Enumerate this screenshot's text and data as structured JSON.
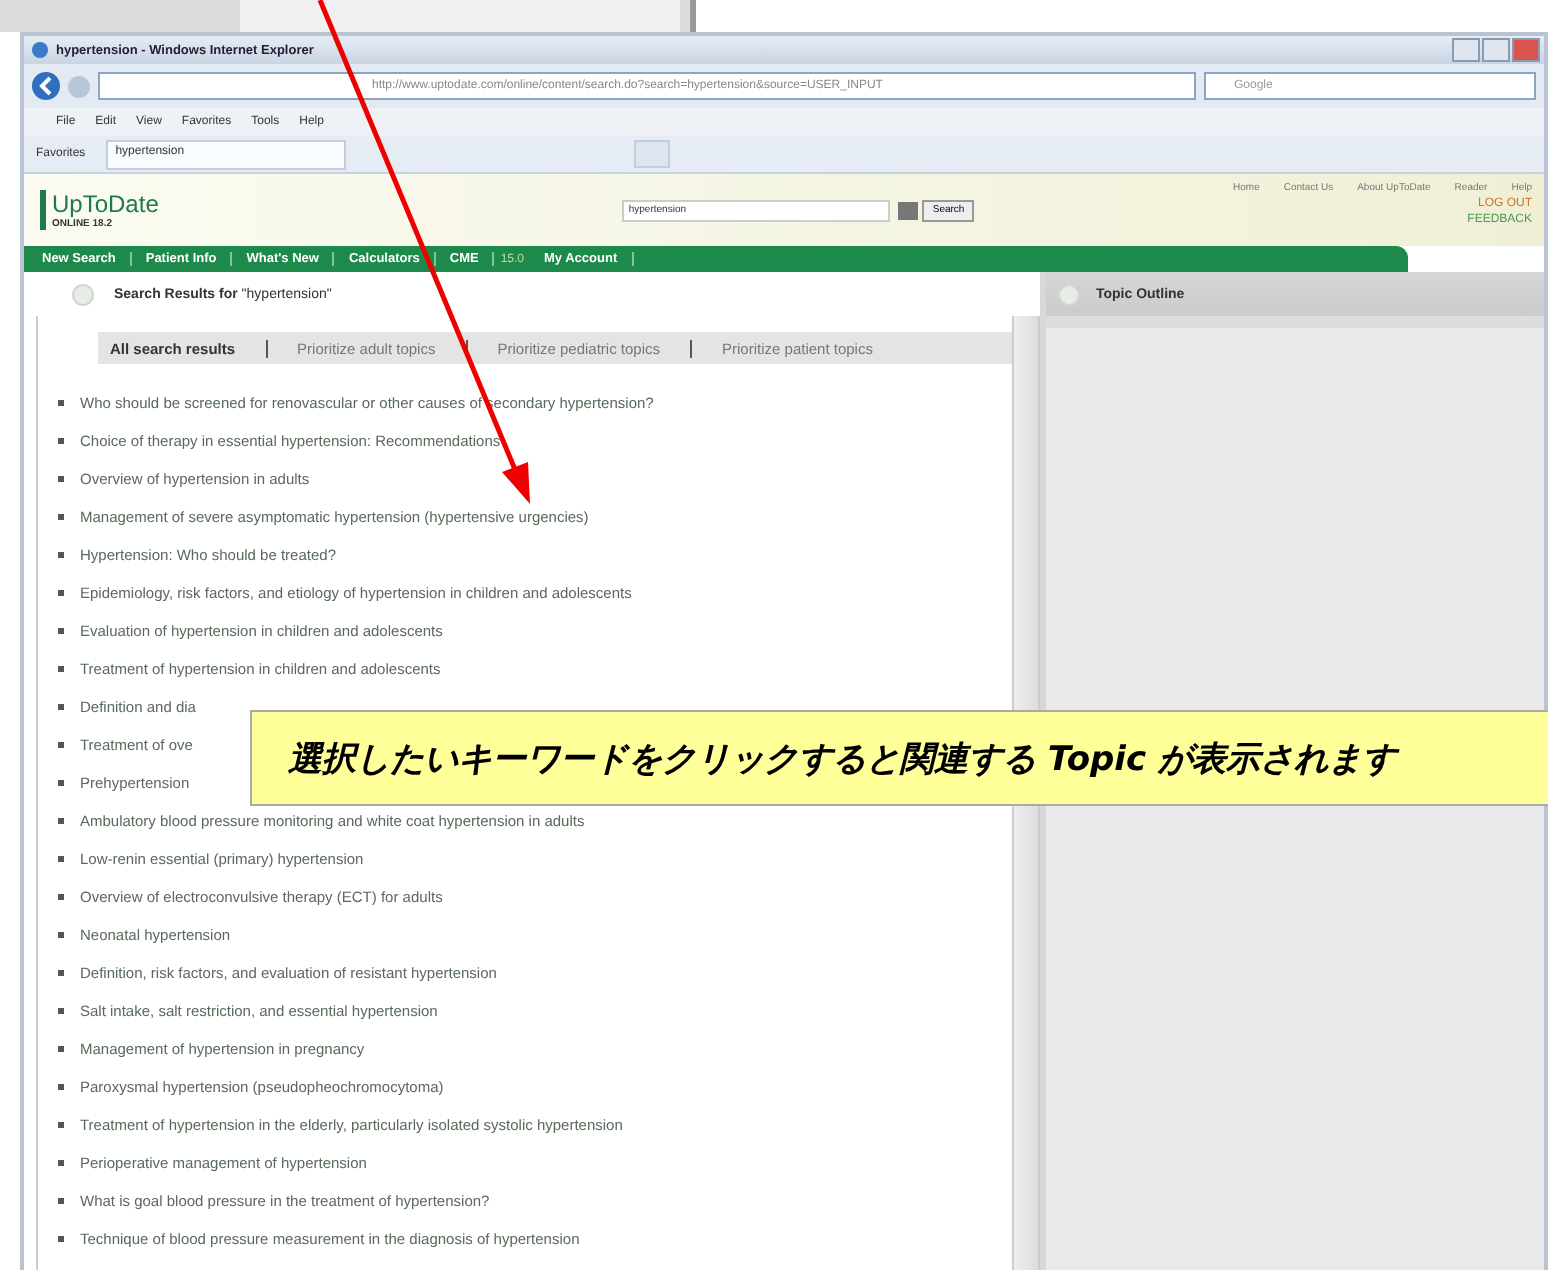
{
  "window": {
    "title": "hypertension - Windows Internet Explorer"
  },
  "address_bar": {
    "url": "http://www.uptodate.com/online/content/search.do?search=hypertension&source=USER_INPUT",
    "search_placeholder": "Google"
  },
  "menu": [
    "File",
    "Edit",
    "View",
    "Favorites",
    "Tools",
    "Help"
  ],
  "favorites_bar": {
    "label": "Favorites",
    "tab": "hypertension"
  },
  "site": {
    "logo": "UpToDate",
    "edition": "ONLINE 18.2",
    "search_value": "hypertension",
    "search_button": "Search",
    "top_links": [
      "Home",
      "Contact Us",
      "About UpToDate",
      "Reader",
      "Help"
    ],
    "side_links": [
      "LOG OUT",
      "FEEDBACK"
    ],
    "nav": [
      {
        "label": "New Search",
        "kind": "link"
      },
      {
        "label": "Patient Info",
        "kind": "link"
      },
      {
        "label": "What's New",
        "kind": "link"
      },
      {
        "label": "Calculators",
        "kind": "link"
      },
      {
        "label": "CME",
        "kind": "link"
      },
      {
        "label": "15.0",
        "kind": "count"
      },
      {
        "label": "My Account",
        "kind": "link"
      }
    ]
  },
  "results": {
    "heading": "Search Results for",
    "query": "\"hypertension\"",
    "filters": [
      {
        "label": "All search results",
        "selected": true
      },
      {
        "label": "Prioritize adult topics",
        "selected": false
      },
      {
        "label": "Prioritize pediatric topics",
        "selected": false
      },
      {
        "label": "Prioritize patient topics",
        "selected": false
      }
    ],
    "items": [
      "Who should be screened for renovascular or other causes of secondary hypertension?",
      "Choice of therapy in essential hypertension: Recommendations",
      "Overview of hypertension in adults",
      "Management of severe asymptomatic hypertension (hypertensive urgencies)",
      "Hypertension: Who should be treated?",
      "Epidemiology, risk factors, and etiology of hypertension in children and adolescents",
      "Evaluation of hypertension in children and adolescents",
      "Treatment of hypertension in children and adolescents",
      "Definition and dia",
      "Treatment of ove",
      "Prehypertension",
      "Ambulatory blood pressure monitoring and white coat hypertension in adults",
      "Low-renin essential (primary) hypertension",
      "Overview of electroconvulsive therapy (ECT) for adults",
      "Neonatal hypertension",
      "Definition, risk factors, and evaluation of resistant hypertension",
      "Salt intake, salt restriction, and essential hypertension",
      "Management of hypertension in pregnancy",
      "Paroxysmal hypertension (pseudopheochromocytoma)",
      "Treatment of hypertension in the elderly, particularly isolated systolic hypertension",
      "Perioperative management of hypertension",
      "What is goal blood pressure in the treatment of hypertension?",
      "Technique of blood pressure measurement in the diagnosis of hypertension"
    ]
  },
  "outline": {
    "title": "Topic Outline"
  },
  "callout": {
    "text": "選択したいキーワードをクリックすると関連する Topic が表示されます"
  }
}
